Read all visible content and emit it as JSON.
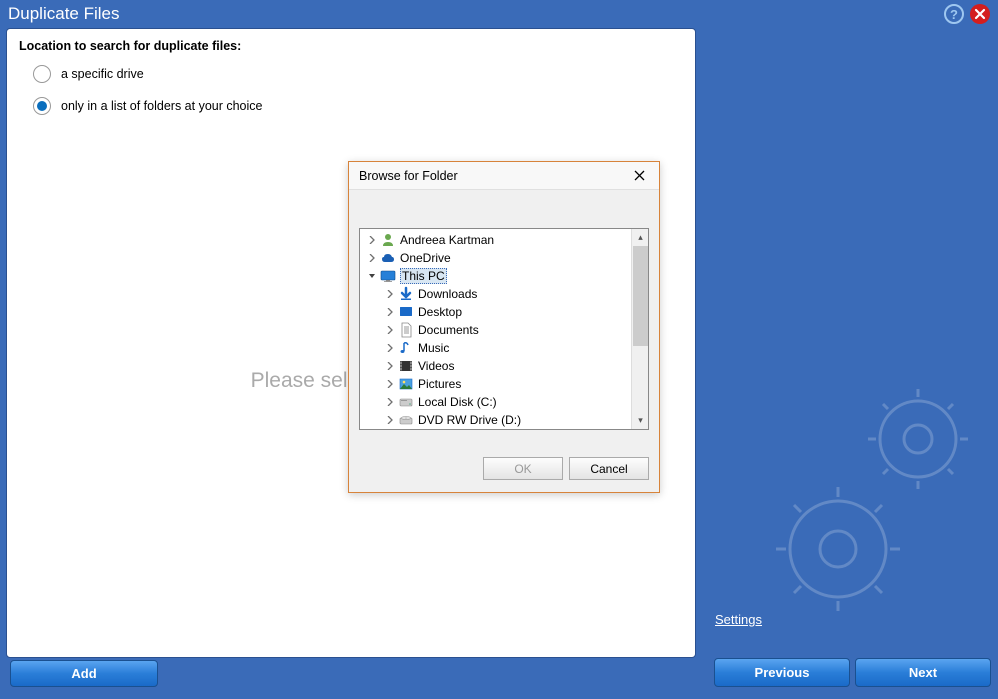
{
  "window": {
    "title": "Duplicate Files"
  },
  "main": {
    "prompt": "Location to search for duplicate files:",
    "options": {
      "drive": "a specific drive",
      "folders": "only in a list of folders at your choice"
    },
    "selected_option": "folders",
    "placeholder": "Please select a folder",
    "add_button": "Add"
  },
  "sidebar": {
    "settings_link": "Settings",
    "prev_button": "Previous",
    "next_button": "Next"
  },
  "dialog": {
    "title": "Browse for Folder",
    "ok": "OK",
    "cancel": "Cancel",
    "tree": [
      {
        "level": 0,
        "expanded": false,
        "icon": "user",
        "label": "Andreea Kartman"
      },
      {
        "level": 0,
        "expanded": false,
        "icon": "cloud",
        "label": "OneDrive"
      },
      {
        "level": 0,
        "expanded": true,
        "icon": "monitor",
        "label": "This PC",
        "selected": true
      },
      {
        "level": 1,
        "expanded": false,
        "icon": "download",
        "label": "Downloads"
      },
      {
        "level": 1,
        "expanded": false,
        "icon": "desktop",
        "label": "Desktop"
      },
      {
        "level": 1,
        "expanded": false,
        "icon": "document",
        "label": "Documents"
      },
      {
        "level": 1,
        "expanded": false,
        "icon": "music",
        "label": "Music"
      },
      {
        "level": 1,
        "expanded": false,
        "icon": "video",
        "label": "Videos"
      },
      {
        "level": 1,
        "expanded": false,
        "icon": "picture",
        "label": "Pictures"
      },
      {
        "level": 1,
        "expanded": false,
        "icon": "disk",
        "label": "Local Disk (C:)"
      },
      {
        "level": 1,
        "expanded": false,
        "icon": "dvd",
        "label": "DVD RW Drive (D:)"
      }
    ]
  }
}
